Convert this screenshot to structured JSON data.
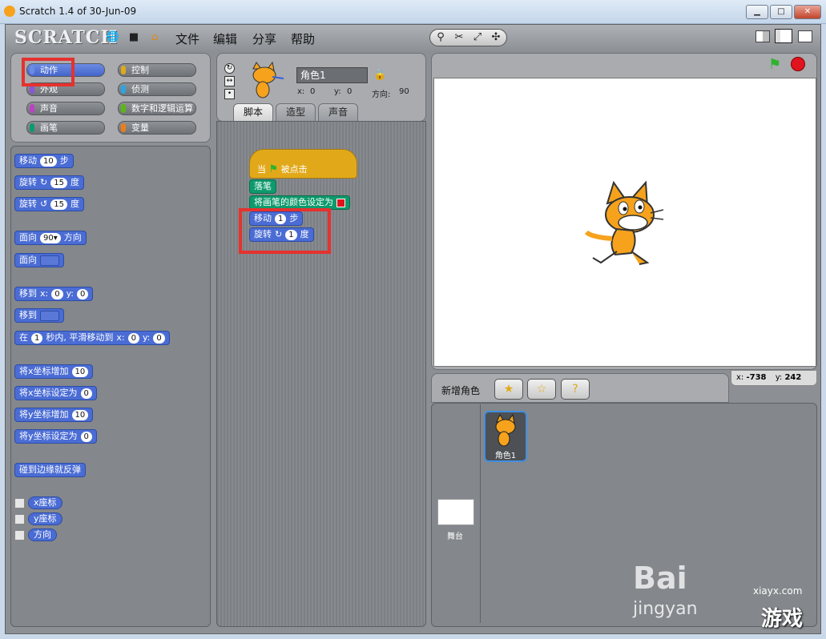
{
  "window": {
    "title": "Scratch 1.4 of 30-Jun-09",
    "min_label": "▁",
    "max_label": "□",
    "close_label": "✕"
  },
  "menubar": {
    "logo": "SCRATCH",
    "items": [
      "文件",
      "编辑",
      "分享",
      "帮助"
    ]
  },
  "categories": [
    {
      "label": "动作",
      "color": "#4a6cd4",
      "active": true
    },
    {
      "label": "控制",
      "color": "#e1a91a"
    },
    {
      "label": "外观",
      "color": "#8a55d7"
    },
    {
      "label": "侦测",
      "color": "#2ca5e2"
    },
    {
      "label": "声音",
      "color": "#bb42c3"
    },
    {
      "label": "数字和逻辑运算",
      "color": "#5cb712"
    },
    {
      "label": "画笔",
      "color": "#0e9a6c"
    },
    {
      "label": "变量",
      "color": "#ee7d16"
    }
  ],
  "palette": {
    "move": {
      "label": "移动",
      "value": "10",
      "unit": "步"
    },
    "turn_right": {
      "label": "旋转",
      "value": "15",
      "unit": "度"
    },
    "turn_left": {
      "label": "旋转",
      "value": "15",
      "unit": "度"
    },
    "point_dir": {
      "label": "面向",
      "value": "90▾",
      "unit": "方向"
    },
    "point_towards": {
      "label": "面向"
    },
    "goto_xy": {
      "label": "移到",
      "x_label": "x:",
      "x": "0",
      "y_label": "y:",
      "y": "0"
    },
    "goto": {
      "label": "移到"
    },
    "glide": {
      "label": "在",
      "secs": "1",
      "text": "秒内, 平滑移动到",
      "x_label": "x:",
      "x": "0",
      "y_label": "y:",
      "y": "0"
    },
    "change_x": {
      "label": "将x坐标增加",
      "value": "10"
    },
    "set_x": {
      "label": "将x坐标设定为",
      "value": "0"
    },
    "change_y": {
      "label": "将y坐标增加",
      "value": "10"
    },
    "set_y": {
      "label": "将y坐标设定为",
      "value": "0"
    },
    "bounce": {
      "label": "碰到边缘就反弹"
    },
    "reporters": [
      "x座标",
      "y座标",
      "方向"
    ]
  },
  "sprite_info": {
    "name": "角色1",
    "x_label": "x:",
    "x": "0",
    "y_label": "y:",
    "y": "0",
    "dir_label": "方向:",
    "dir": "90"
  },
  "tabs": [
    "脚本",
    "造型",
    "声音"
  ],
  "script": {
    "hat": {
      "prefix": "当",
      "suffix": "被点击"
    },
    "pen_down": "落笔",
    "set_pen_color": "将画笔的颜色设定为",
    "move": {
      "label": "移动",
      "value": "1",
      "unit": "步"
    },
    "turn": {
      "label": "旋转",
      "value": "1",
      "unit": "度"
    }
  },
  "stage": {
    "mouse_x_label": "x:",
    "mouse_x": "-738",
    "mouse_y_label": "y:",
    "mouse_y": "242"
  },
  "sprite_list": {
    "new_sprite_label": "新增角色",
    "sprites": [
      "角色1"
    ],
    "stage_label": "舞台"
  },
  "watermark": {
    "site": "xiayx.com",
    "brand": "Bai",
    "sub": "jingyan",
    "game": "游戏"
  },
  "colors": {
    "pen_color": "#e0141e",
    "highlight": "#e5322f"
  }
}
